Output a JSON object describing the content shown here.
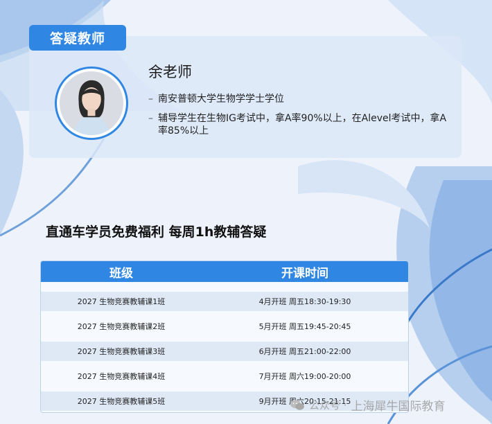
{
  "section_tag": "答疑教师",
  "teacher": {
    "name": "余老师",
    "credentials": [
      "南安普顿大学生物学学士学位",
      "辅导学生在生物IG考试中，拿A率90%以上，在Alevel考试中，拿A率85%以上"
    ],
    "bullet_symbol": "–"
  },
  "headline": "直通车学员免费福利 每周1h教辅答疑",
  "schedule_table": {
    "headers": [
      "班级",
      "开课时间"
    ],
    "rows": [
      [
        "2027 生物竞赛教辅课1班",
        "4月开班 周五18:30-19:30"
      ],
      [
        "2027 生物竞赛教辅课2班",
        "5月开班 周五19:45-20:45"
      ],
      [
        "2027 生物竞赛教辅课3班",
        "6月开班 周五21:00-22:00"
      ],
      [
        "2027 生物竞赛教辅课4班",
        "7月开班 周六19:00-20:00"
      ],
      [
        "2027 生物竞赛教辅课5班",
        "9月开班 周六20:15-21:15"
      ]
    ]
  },
  "watermark": {
    "prefix": "公众号 ·",
    "brand": "上海犀牛国际教育"
  },
  "colors": {
    "accent": "#2f87e3",
    "background": "#eef3fb",
    "card": "#dce8f8"
  }
}
